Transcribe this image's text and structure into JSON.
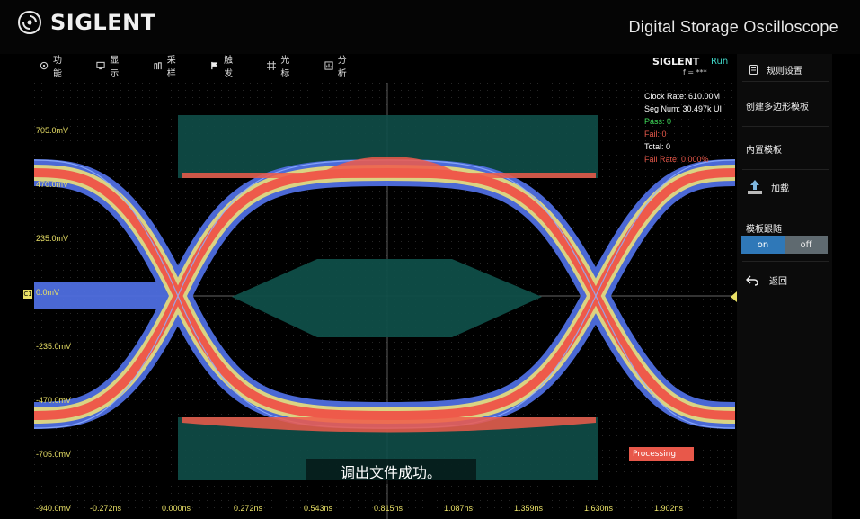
{
  "brand": "SIGLENT",
  "model_title": "Digital Storage Oscilloscope",
  "menu": [
    {
      "label": "功能",
      "icon": "function-icon"
    },
    {
      "label": "显示",
      "icon": "display-icon"
    },
    {
      "label": "采样",
      "icon": "sample-icon"
    },
    {
      "label": "触发",
      "icon": "trigger-icon"
    },
    {
      "label": "光标",
      "icon": "cursor-icon"
    },
    {
      "label": "分析",
      "icon": "analysis-icon"
    }
  ],
  "status": {
    "brand": "SIGLENT",
    "run": "Run",
    "freq": "f = ***"
  },
  "side_panel": {
    "title": "规则设置",
    "create_poly": "创建多边形模板",
    "builtin": "内置模板",
    "load": "加载",
    "follow": "模板跟随",
    "on": "on",
    "off": "off",
    "back": "返回"
  },
  "info": {
    "clock_rate": "Clock Rate: 610.00M",
    "seg_num": "Seg Num: 30.497k UI",
    "pass": "Pass: 0",
    "fail": "Fail: 0",
    "total": "Total: 0",
    "fail_rate": "Fail Rate: 0.000%"
  },
  "colors": {
    "pass": "#3fdc5a",
    "fail": "#e8584a",
    "accent": "#3fd7c8",
    "axis_label": "#e9e066"
  },
  "volt_labels": [
    "705.0mV",
    "470.0mV",
    "235.0mV",
    "0.0mV",
    "-235.0mV",
    "-470.0mV",
    "-705.0mV",
    "-940.0mV"
  ],
  "time_labels": [
    "-0.272ns",
    "0.000ns",
    "0.272ns",
    "0.543ns",
    "0.815ns",
    "1.087ns",
    "1.359ns",
    "1.630ns",
    "1.902ns"
  ],
  "channel_marker": "C1",
  "processing": "Processing",
  "subtitle": "调出文件成功。"
}
